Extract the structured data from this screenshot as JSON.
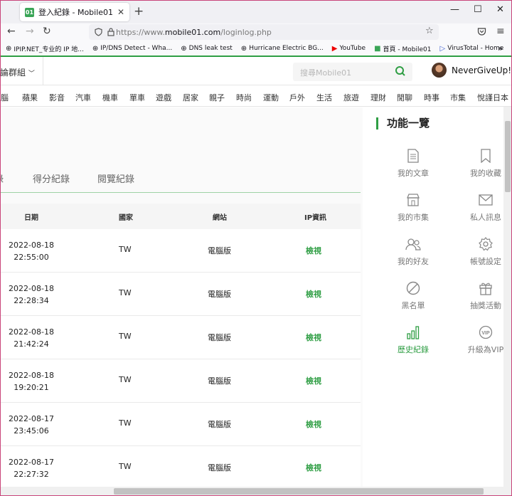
{
  "browser": {
    "tab_title": "登入紀錄 - Mobile01",
    "tab_favicon": "01",
    "url_prefix": "https://www.",
    "url_domain": "mobile01.com",
    "url_path": "/loginlog.php",
    "bookmarks": [
      {
        "label": "IPIP.NET_专业的 IP 地...",
        "icon": "globe-icon"
      },
      {
        "label": "IP/DNS Detect - Wha...",
        "icon": "globe-icon"
      },
      {
        "label": "DNS leak test",
        "icon": "globe-icon"
      },
      {
        "label": "Hurricane Electric BG...",
        "icon": "globe-icon"
      },
      {
        "label": "YouTube",
        "icon": "youtube-icon"
      },
      {
        "label": "首頁 - Mobile01",
        "icon": "mobile01-icon"
      },
      {
        "label": "VirusTotal - Home",
        "icon": "virustotal-icon"
      }
    ]
  },
  "header": {
    "forum_group": "討論群組",
    "search_placeholder": "搜尋Mobile01",
    "username": "NeverGiveUp!!"
  },
  "categories": [
    "電腦",
    "蘋果",
    "影音",
    "汽車",
    "機車",
    "單車",
    "遊戲",
    "居家",
    "親子",
    "時尚",
    "運動",
    "戶外",
    "生活",
    "旅遊",
    "理財",
    "閒聊",
    "時事",
    "市集",
    "悅謹日本"
  ],
  "subtabs": [
    "錄",
    "得分紀錄",
    "閱覽紀錄"
  ],
  "table": {
    "headers": [
      "日期",
      "國家",
      "網站",
      "IP資訊"
    ],
    "rows": [
      {
        "date": "2022-08-18",
        "time": "22:55:00",
        "country": "TW",
        "site": "電腦版",
        "ip": "檢視"
      },
      {
        "date": "2022-08-18",
        "time": "22:28:34",
        "country": "TW",
        "site": "電腦版",
        "ip": "檢視"
      },
      {
        "date": "2022-08-18",
        "time": "21:42:24",
        "country": "TW",
        "site": "電腦版",
        "ip": "檢視"
      },
      {
        "date": "2022-08-18",
        "time": "19:20:21",
        "country": "TW",
        "site": "電腦版",
        "ip": "檢視"
      },
      {
        "date": "2022-08-17",
        "time": "23:45:06",
        "country": "TW",
        "site": "電腦版",
        "ip": "檢視"
      },
      {
        "date": "2022-08-17",
        "time": "22:27:32",
        "country": "TW",
        "site": "電腦版",
        "ip": "檢視"
      }
    ]
  },
  "sidebar": {
    "title": "功能一覽",
    "items": [
      {
        "label": "我的文章",
        "icon": "document-icon"
      },
      {
        "label": "我的收藏",
        "icon": "bookmark-icon"
      },
      {
        "label": "我的市集",
        "icon": "store-icon"
      },
      {
        "label": "私人訊息",
        "icon": "mail-icon"
      },
      {
        "label": "我的好友",
        "icon": "friends-icon"
      },
      {
        "label": "帳號設定",
        "icon": "gear-icon"
      },
      {
        "label": "黑名單",
        "icon": "block-icon"
      },
      {
        "label": "抽獎活動",
        "icon": "gift-icon"
      },
      {
        "label": "歷史紀錄",
        "icon": "bar-chart-icon",
        "active": true
      },
      {
        "label": "升級為VIP",
        "icon": "vip-icon"
      }
    ]
  },
  "colors": {
    "accent": "#2f9e44",
    "frame": "#c9457a"
  }
}
